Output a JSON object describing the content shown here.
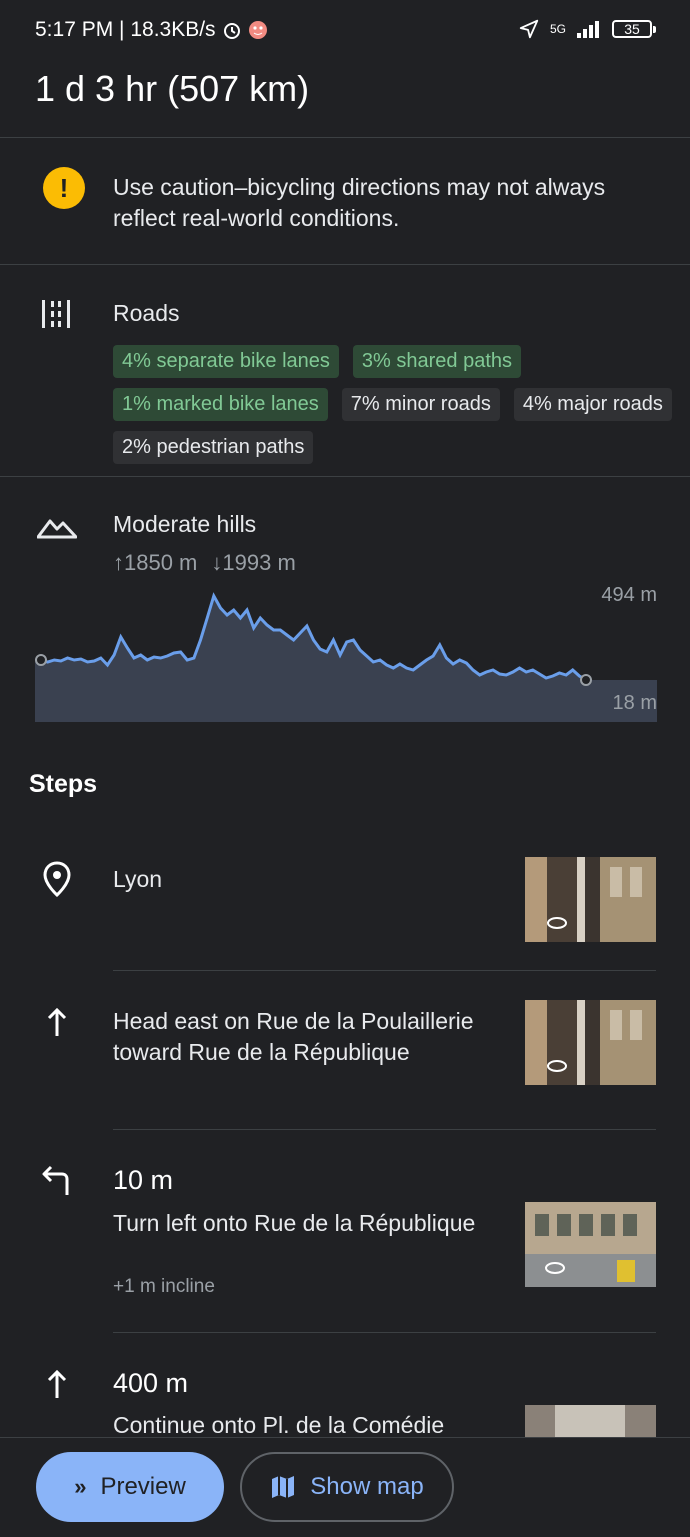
{
  "status_bar": {
    "time_speed": "5:17 PM | 18.3KB/s",
    "network": "5G",
    "battery": "35"
  },
  "header": {
    "title": "1 d 3 hr (507 km)"
  },
  "caution": {
    "text": "Use caution–bicycling directions may not always reflect real-world conditions.",
    "icon": "warning-icon"
  },
  "roads": {
    "label": "Roads",
    "chips": [
      {
        "text": "4% separate bike lanes",
        "highlight": true
      },
      {
        "text": "3% shared paths",
        "highlight": true
      },
      {
        "text": "1% marked bike lanes",
        "highlight": true
      },
      {
        "text": "7% minor roads",
        "highlight": false
      },
      {
        "text": "4% major roads",
        "highlight": false
      },
      {
        "text": "2% pedestrian paths",
        "highlight": false
      }
    ]
  },
  "hills": {
    "label": "Moderate hills",
    "ascent": "1850 m",
    "descent": "1993 m",
    "max_label": "494 m",
    "min_label": "18 m"
  },
  "elevation_profile": [
    170,
    172,
    170,
    171,
    168,
    170,
    169,
    172,
    171,
    168,
    175,
    165,
    147,
    158,
    168,
    165,
    170,
    167,
    168,
    166,
    163,
    162,
    170,
    168,
    150,
    128,
    106,
    118,
    125,
    120,
    128,
    120,
    138,
    128,
    135,
    140,
    140,
    145,
    150,
    143,
    136,
    150,
    159,
    162,
    150,
    165,
    152,
    150,
    160,
    166,
    172,
    170,
    175,
    178,
    174,
    178,
    180,
    175,
    170,
    166,
    155,
    168,
    174,
    170,
    173,
    180,
    185,
    182,
    180,
    184,
    185,
    182,
    178,
    182,
    180,
    184,
    188,
    186,
    183,
    185,
    180,
    186,
    190
  ],
  "steps": {
    "heading": "Steps",
    "items": [
      {
        "distance": "",
        "text": "Lyon",
        "sub": ""
      },
      {
        "distance": "",
        "text": "Head east on Rue de la Poulaillerie toward Rue de la République",
        "sub": ""
      },
      {
        "distance": "10 m",
        "text": "Turn left onto Rue de la République",
        "sub": "+1 m incline"
      },
      {
        "distance": "400 m",
        "text": "Continue onto Pl. de la Comédie",
        "sub": ""
      }
    ]
  },
  "actions": {
    "preview": "Preview",
    "show_map": "Show map"
  },
  "colors": {
    "accent": "#8ab4f8",
    "warning": "#fbbc04",
    "bike_green": "#81c995",
    "profile_line": "#6a9eea"
  }
}
